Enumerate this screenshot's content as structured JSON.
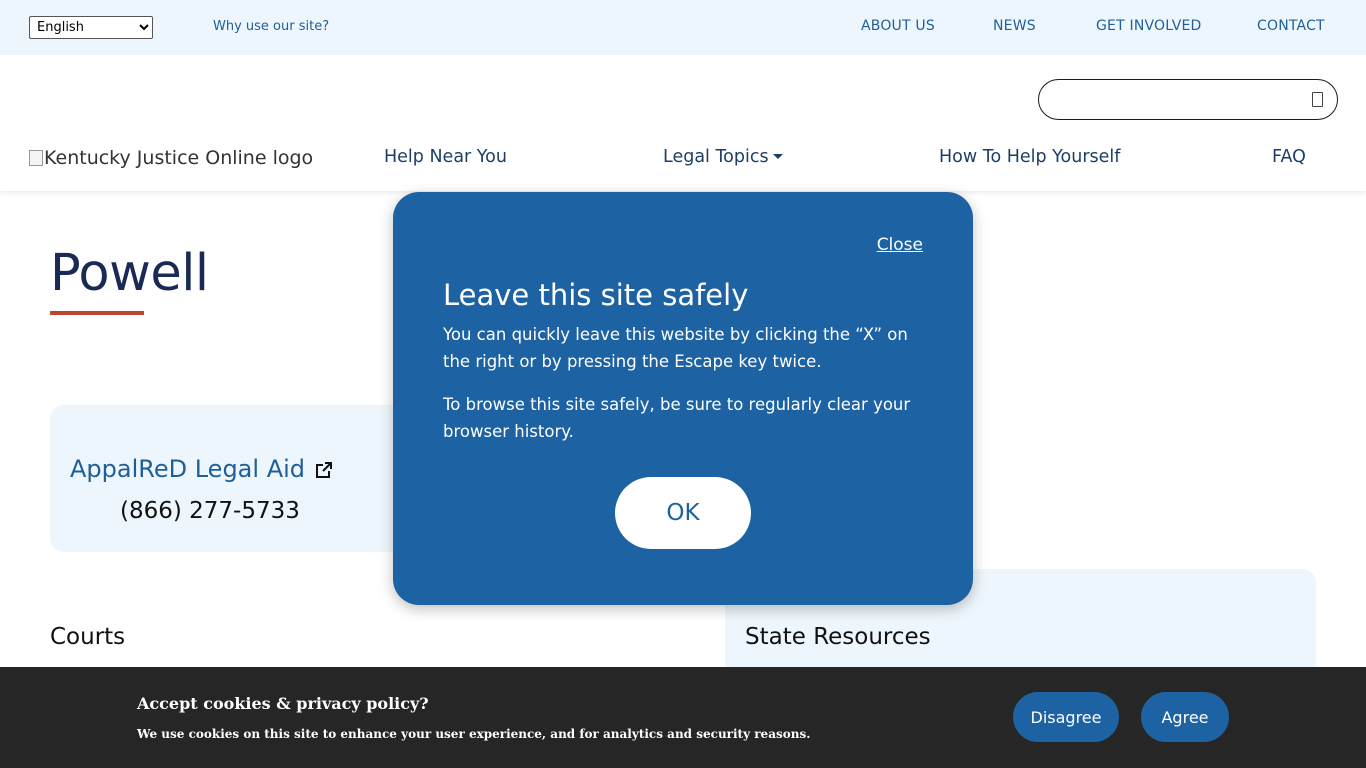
{
  "topbar": {
    "language_selected": "English",
    "why_link": "Why use our site?",
    "nav": [
      "ABOUT US",
      "NEWS",
      "GET INVOLVED",
      "CONTACT"
    ]
  },
  "header": {
    "logo_alt": "Kentucky Justice Online logo",
    "search_placeholder": "",
    "nav": {
      "help_near_you": "Help Near You",
      "legal_topics": "Legal Topics",
      "how_to_help": "How To Help Yourself",
      "faq": "FAQ"
    }
  },
  "page": {
    "title": "Powell",
    "card_left": {
      "org_name": "AppalReD Legal Aid",
      "phone": "(866) 277-5733"
    },
    "courts_heading": "Courts",
    "state_resources_heading": "State Resources"
  },
  "modal": {
    "close_label": "Close",
    "title": "Leave this site safely",
    "paragraph1": "You can quickly leave this website by clicking the “X” on the right or by pressing the Escape key twice.",
    "paragraph2": "To browse this site safely, be sure to regularly clear your browser history.",
    "ok_label": "OK"
  },
  "cookie": {
    "title": "Accept cookies & privacy policy?",
    "text": "We use cookies on this site to enhance your user experience, and for analytics and security reasons.",
    "disagree_label": "Disagree",
    "agree_label": "Agree"
  },
  "colors": {
    "primary_blue": "#1d62a3",
    "light_bg": "#eef6fd",
    "accent_red": "#c0432b",
    "banner_dark": "#262626"
  }
}
